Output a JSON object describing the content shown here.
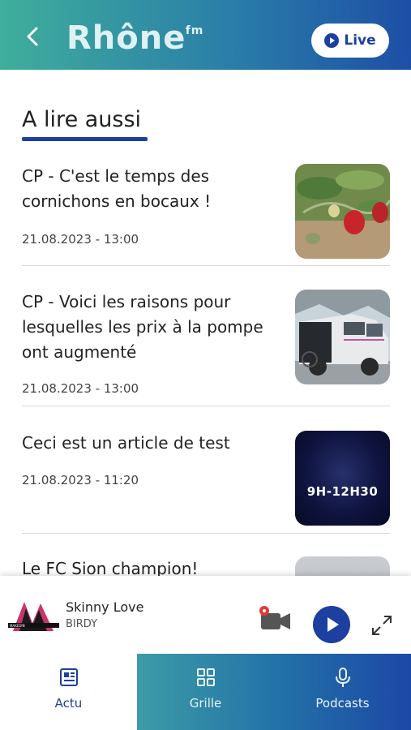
{
  "header": {
    "logo_text": "Rhône",
    "logo_suffix": "fm",
    "live_label": "Live"
  },
  "section": {
    "title": "A lire aussi"
  },
  "articles": [
    {
      "title": "CP - C'est le temps des cornichons en bocaux !",
      "date": "21.08.2023 - 13:00",
      "thumb": "strawberries-photo"
    },
    {
      "title": "CP - Voici les raisons pour lesquelles les prix à la pompe ont augmenté",
      "date": "21.08.2023 - 13:00",
      "thumb": "van-photo"
    },
    {
      "title": "Ceci est un article de test",
      "date": "21.08.2023 - 11:20",
      "thumb_text": "9H-12H30"
    },
    {
      "title": "Le FC Sion champion!",
      "date": "",
      "thumb": "sky-photo"
    }
  ],
  "player": {
    "song": "Skinny Love",
    "artist": "BIRDY"
  },
  "tabs": [
    {
      "label": "Actu",
      "icon": "news-icon"
    },
    {
      "label": "Grille",
      "icon": "grid-icon"
    },
    {
      "label": "Podcasts",
      "icon": "microphone-icon"
    }
  ],
  "colors": {
    "brand_blue": "#1c3fa0",
    "header_gradient_start": "#3fae9c",
    "header_gradient_end": "#1d4fa6"
  }
}
